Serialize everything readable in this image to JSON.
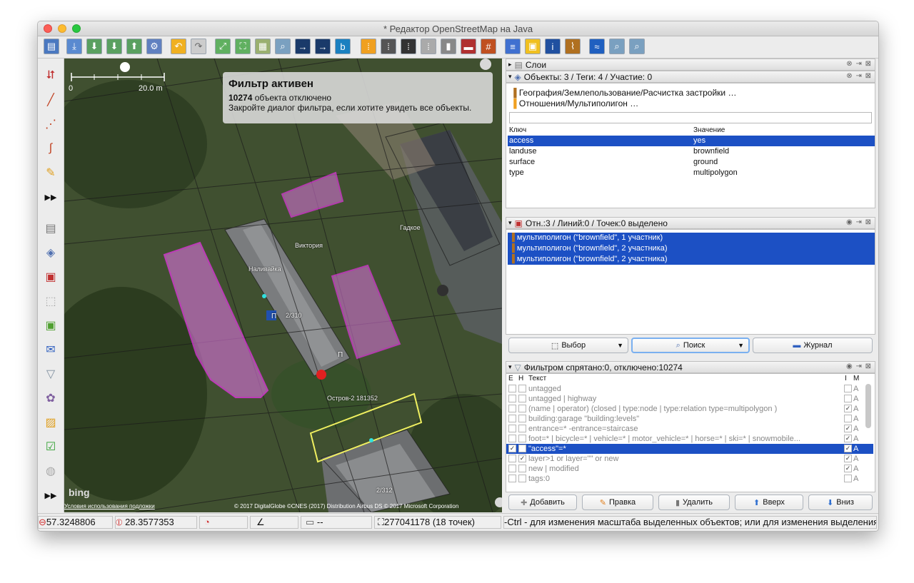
{
  "window": {
    "title": "* Редактор OpenStreetMap на Java"
  },
  "map": {
    "scale_start": "0",
    "scale_end": "20.0 m",
    "filter_overlay": {
      "title": "Фильтр активен",
      "count": "10274",
      "count_suffix": " объекта отключено",
      "hint": "Закройте диалог фильтра, если хотите увидеть все объекты."
    },
    "labels": {
      "viktoria": "Виктория",
      "nalivaika": "Наливайка",
      "bld_2_310": "2/310",
      "bld_2_312": "2/312",
      "ostrov": "Остров-2 181352",
      "parking1": "П",
      "parking2": "П",
      "gadkoe": "Гадкое"
    },
    "attribution": {
      "bing": "bing",
      "terms": "Условия использования подложки",
      "copyright": "© 2017 DigitalGlobe ©CNES (2017) Distribution Airbus DS © 2017 Microsoft Corporation"
    }
  },
  "layers_panel": {
    "title": "Слои"
  },
  "objects_panel": {
    "title": "Объекты: 3 / Теги: 4 / Участие: 0",
    "preset1": "География/Землепользование/Расчистка застройки …",
    "preset2": "Отношения/Мультиполигон …",
    "col_key": "Ключ",
    "col_value": "Значение",
    "tags": [
      {
        "key": "access",
        "value": "yes"
      },
      {
        "key": "landuse",
        "value": "brownfield"
      },
      {
        "key": "surface",
        "value": "ground"
      },
      {
        "key": "type",
        "value": "multipolygon"
      }
    ]
  },
  "selection_panel": {
    "title": "Отн.:3 / Линий:0 / Точек:0 выделено",
    "items": [
      "мультиполигон (\"brownfield\", 1 участник)",
      "мультиполигон (\"brownfield\", 2 участника)",
      "мультиполигон (\"brownfield\", 2 участника)"
    ],
    "btn_select": "Выбор",
    "btn_search": "Поиск",
    "btn_history": "Журнал"
  },
  "filter_panel": {
    "title": "Фильтром спрятано:0, отключено:10274",
    "col_e": "E",
    "col_h": "H",
    "col_text": "Текст",
    "col_i": "I",
    "col_m": "M",
    "rows": [
      {
        "text": "untagged",
        "e": "",
        "h": "",
        "i": "",
        "m": "A"
      },
      {
        "text": "untagged | highway",
        "e": "",
        "h": "",
        "i": "",
        "m": "A"
      },
      {
        "text": "(name | operator) (closed | type:node | type:relation type=multipolygon )",
        "e": "",
        "h": "",
        "i": "✓",
        "m": "A"
      },
      {
        "text": "building:garage \"building:levels\"",
        "e": "",
        "h": "",
        "i": "",
        "m": "A"
      },
      {
        "text": "entrance=* -entrance=staircase",
        "e": "",
        "h": "",
        "i": "✓",
        "m": "A"
      },
      {
        "text": "foot=* | bicycle=* | vehicle=* | motor_vehicle=* | horse=* | ski=* | snowmobile...",
        "e": "",
        "h": "",
        "i": "✓",
        "m": "A"
      },
      {
        "text": "\"access\"=*",
        "e": "✓",
        "h": "",
        "i": "✓",
        "m": "A"
      },
      {
        "text": "layer>1 or layer=\"\" or new",
        "e": "",
        "h": "✓",
        "i": "✓",
        "m": "A"
      },
      {
        "text": "new | modified",
        "e": "",
        "h": "",
        "i": "✓",
        "m": "A"
      },
      {
        "text": "tags:0",
        "e": "",
        "h": "",
        "i": "",
        "m": "A"
      }
    ],
    "btn_add": "Добавить",
    "btn_edit": "Правка",
    "btn_delete": "Удалить",
    "btn_up": "Вверх",
    "btn_down": "Вниз"
  },
  "status": {
    "lat": "57.3248806",
    "lon": "28.3577353",
    "distance": "--",
    "way": "277041178 (18 точек)",
    "help": "-Ctrl - для изменения масштаба выделенных объектов; или для изменения выделения"
  },
  "colors": {
    "selection": "#1c50c4",
    "multipolygon": "#e020e0",
    "highlight": "#f0f060"
  }
}
